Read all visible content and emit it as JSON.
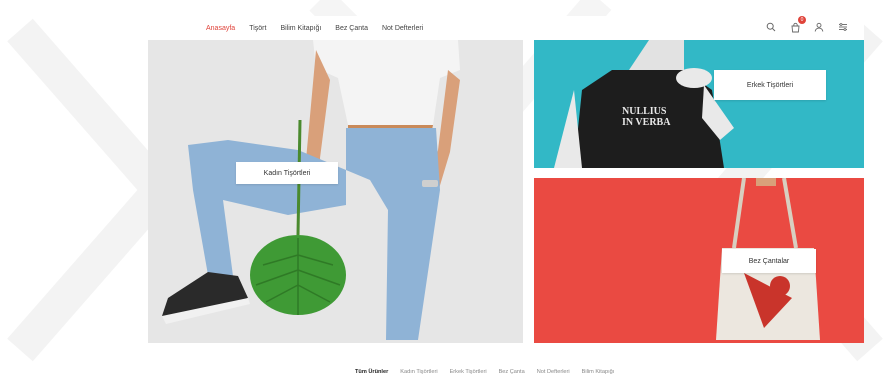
{
  "nav": {
    "items": [
      {
        "label": "Anasayfa",
        "active": true
      },
      {
        "label": "Tişört",
        "active": false
      },
      {
        "label": "Bilim Kitapığı",
        "active": false
      },
      {
        "label": "Bez Çanta",
        "active": false
      },
      {
        "label": "Not Defterleri",
        "active": false
      }
    ]
  },
  "header_icons": {
    "search": "search-icon",
    "cart": "cart-icon",
    "cart_count": "0",
    "user": "user-icon",
    "menu": "menu-icon"
  },
  "banners": {
    "women": {
      "label": "Kadın Tişörtleri"
    },
    "men": {
      "label": "Erkek Tişörtleri",
      "print": [
        "NULLIUS",
        "IN VERBA"
      ]
    },
    "bags": {
      "label": "Bez Çantalar"
    }
  },
  "filter_tabs": [
    {
      "label": "Tüm Ürünler",
      "active": true
    },
    {
      "label": "Kadın Tişörtleri",
      "active": false
    },
    {
      "label": "Erkek Tişörtleri",
      "active": false
    },
    {
      "label": "Bez Çanta",
      "active": false
    },
    {
      "label": "Not Defterleri",
      "active": false
    },
    {
      "label": "Bilim Kitapığı",
      "active": false
    }
  ],
  "colors": {
    "accent": "#e0433a",
    "teal": "#32b8c6",
    "red": "#ea4a42",
    "light_gray": "#e6e6e6"
  }
}
